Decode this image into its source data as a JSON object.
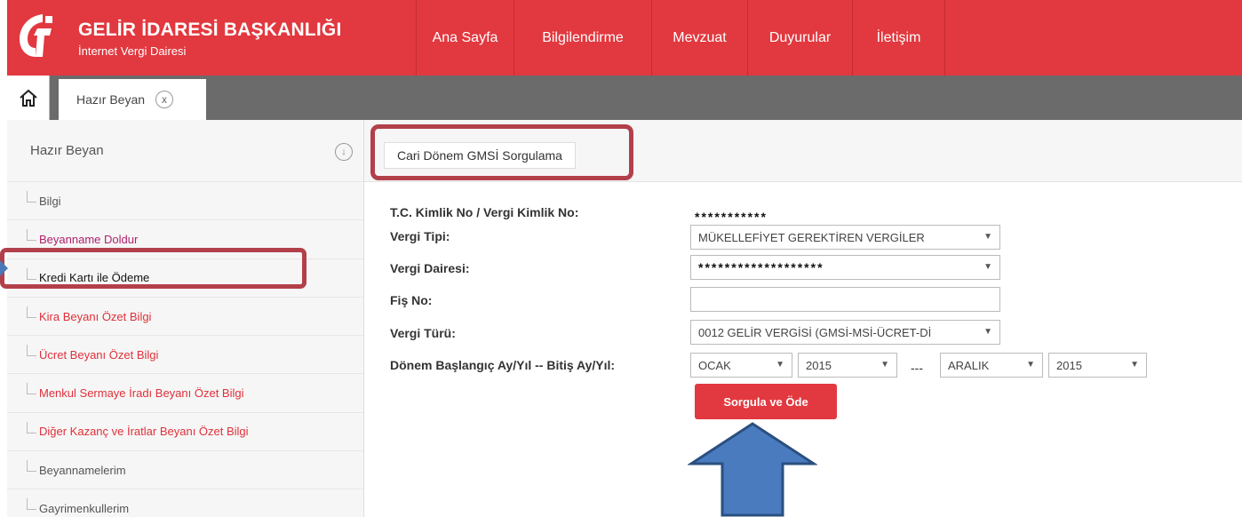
{
  "header": {
    "title": "GELİR İDARESİ BAŞKANLIĞI",
    "subtitle": "İnternet Vergi Dairesi",
    "nav": [
      "Ana Sayfa",
      "Bilgilendirme",
      "Mevzuat",
      "Duyurular",
      "İletişim"
    ],
    "brand_color": "#e2383f"
  },
  "tabbar": {
    "home_icon": "home-icon",
    "tab_label": "Hazır Beyan",
    "tab_close": "x"
  },
  "sidebar": {
    "title": "Hazır Beyan",
    "collapse_icon": "↓",
    "items": [
      {
        "label": "Bilgi",
        "color": "gray"
      },
      {
        "label": "Beyanname Doldur",
        "color": "pink"
      },
      {
        "label": "Kredi Kartı ile Ödeme",
        "color": "black"
      },
      {
        "label": "Kira Beyanı Özet Bilgi",
        "color": "red"
      },
      {
        "label": "Ücret Beyanı Özet Bilgi",
        "color": "red"
      },
      {
        "label": "Menkul Sermaye İradı Beyanı Özet Bilgi",
        "color": "red"
      },
      {
        "label": "Diğer Kazanç ve İratlar Beyanı Özet Bilgi",
        "color": "red"
      },
      {
        "label": "Beyannamelerim",
        "color": "gray"
      },
      {
        "label": "Gayrimenkullerim",
        "color": "gray"
      }
    ]
  },
  "main": {
    "title": "Cari Dönem GMSİ Sorgulama",
    "form": {
      "tc_label": "T.C. Kimlik No / Vergi Kimlik No:",
      "tc_value": "***********",
      "vergi_tipi_label": "Vergi Tipi:",
      "vergi_tipi_value": "MÜKELLEFİYET GEREKTİREN VERGİLER",
      "vergi_dairesi_label": "Vergi Dairesi:",
      "vergi_dairesi_value": "*******************",
      "fis_no_label": "Fiş No:",
      "fis_no_value": "",
      "vergi_turu_label": "Vergi Türü:",
      "vergi_turu_value": "0012 GELİR VERGİSİ (GMSİ-MSİ-ÜCRET-Dİ",
      "donem_label": "Dönem Başlangıç Ay/Yıl -- Bitiş Ay/Yıl:",
      "start_month": "OCAK",
      "start_year": "2015",
      "separator": "---",
      "end_month": "ARALIK",
      "end_year": "2015",
      "select_arrow": "▼"
    },
    "submit_label": "Sorgula ve Öde"
  }
}
